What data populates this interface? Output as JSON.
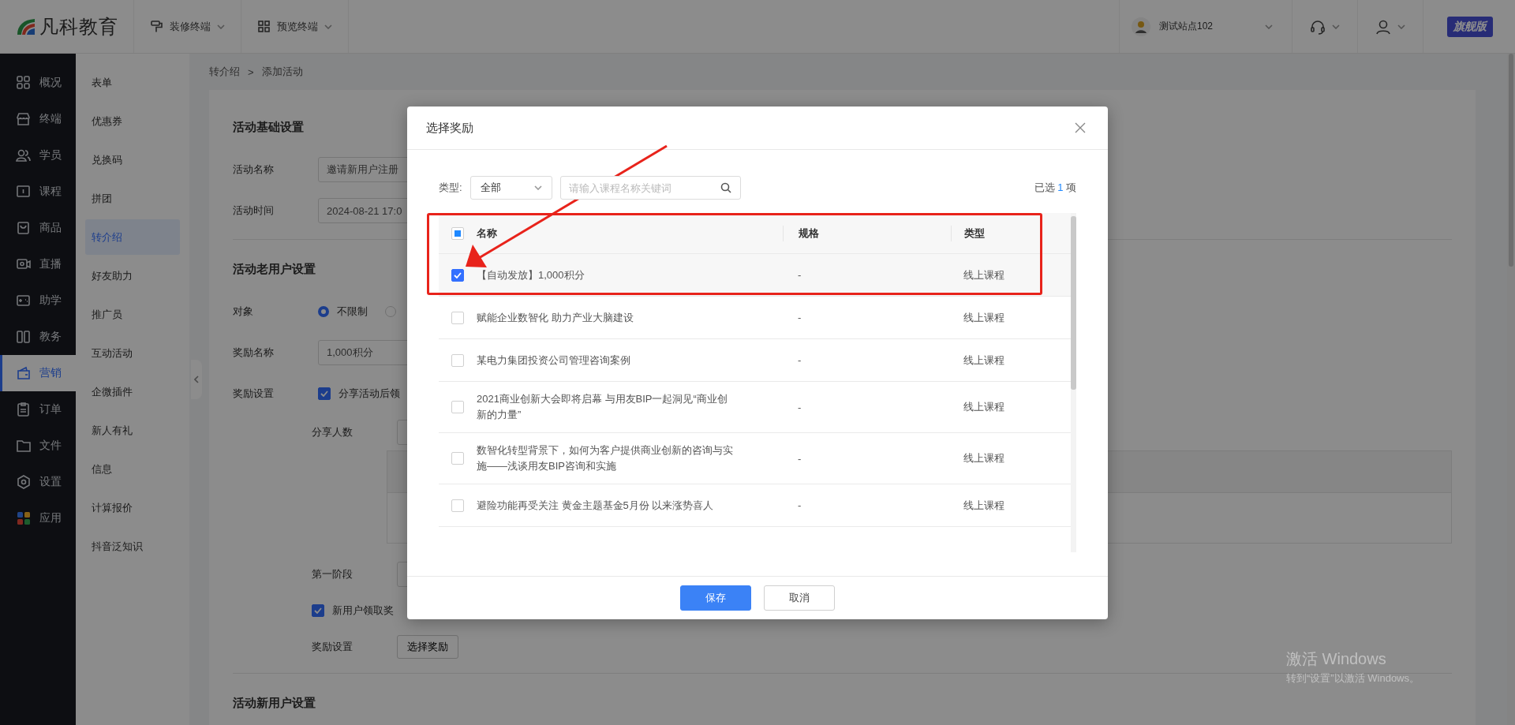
{
  "topbar": {
    "logo_text": "凡科教育",
    "tools": [
      {
        "label": "装修终端"
      },
      {
        "label": "预览终端"
      }
    ],
    "site": {
      "name": "测试站点102"
    },
    "edition_badge": "旗舰版"
  },
  "nav": [
    {
      "label": "概况",
      "selected": false
    },
    {
      "label": "终端",
      "selected": false
    },
    {
      "label": "学员",
      "selected": false
    },
    {
      "label": "课程",
      "selected": false
    },
    {
      "label": "商品",
      "selected": false
    },
    {
      "label": "直播",
      "selected": false
    },
    {
      "label": "助学",
      "selected": false
    },
    {
      "label": "教务",
      "selected": false
    },
    {
      "label": "营销",
      "selected": true
    },
    {
      "label": "订单",
      "selected": false
    },
    {
      "label": "文件",
      "selected": false
    },
    {
      "label": "设置",
      "selected": false
    },
    {
      "label": "应用",
      "selected": false
    }
  ],
  "subnav": [
    {
      "label": "表单",
      "selected": false
    },
    {
      "label": "优惠券",
      "selected": false
    },
    {
      "label": "兑换码",
      "selected": false
    },
    {
      "label": "拼团",
      "selected": false
    },
    {
      "label": "转介绍",
      "selected": true
    },
    {
      "label": "好友助力",
      "selected": false
    },
    {
      "label": "推广员",
      "selected": false
    },
    {
      "label": "互动活动",
      "selected": false
    },
    {
      "label": "企微插件",
      "selected": false
    },
    {
      "label": "新人有礼",
      "selected": false
    },
    {
      "label": "信息",
      "selected": false
    },
    {
      "label": "计算报价",
      "selected": false
    },
    {
      "label": "抖音泛知识",
      "selected": false
    }
  ],
  "breadcrumb": {
    "items": [
      "转介绍",
      "添加活动"
    ],
    "separator": ">"
  },
  "form": {
    "basic_title": "活动基础设置",
    "name_label": "活动名称",
    "name_value": "邀请新用户注册",
    "time_label": "活动时间",
    "time_value": "2024-08-21 17:0",
    "old_title": "活动老用户设置",
    "target_label": "对象",
    "target_options": [
      {
        "label": "不限制",
        "selected": true
      },
      {
        "selected": false
      }
    ],
    "reward_name_label": "奖励名称",
    "reward_name_value": "1,000积分",
    "reward_setting_label": "奖励设置",
    "share_checked": true,
    "share_text": "分享活动后领",
    "share_count_label": "分享人数",
    "stage_label": "第一阶段",
    "newuser_checked": true,
    "newuser_text": "新用户领取奖",
    "reward_setting2_label": "奖励设置",
    "choose_button": "选择奖励",
    "new_title": "活动新用户设置"
  },
  "modal": {
    "title": "选择奖励",
    "type_label": "类型:",
    "type_value": "全部",
    "search": {
      "placeholder": "请输入课程名称关键词"
    },
    "selected_summary": {
      "prefix": "已选",
      "count": "1",
      "suffix": "项"
    },
    "table": {
      "columns": [
        "名称",
        "规格",
        "类型"
      ],
      "header_checkbox": {
        "indeterminate": true
      },
      "rows": [
        {
          "name": "【自动发放】1,000积分",
          "spec": "-",
          "type": "线上课程",
          "checked": true
        },
        {
          "name": "赋能企业数智化 助力产业大脑建设",
          "spec": "-",
          "type": "线上课程",
          "checked": false
        },
        {
          "name": "某电力集团投资公司管理咨询案例",
          "spec": "-",
          "type": "线上课程",
          "checked": false
        },
        {
          "name": "2021商业创新大会即将启幕 与用友BIP一起洞见“商业创新的力量”",
          "spec": "-",
          "type": "线上课程",
          "checked": false
        },
        {
          "name": "数智化转型背景下，如何为客户提供商业创新的咨询与实施——浅谈用友BIP咨询和实施",
          "spec": "-",
          "type": "线上课程",
          "checked": false
        },
        {
          "name": "避险功能再受关注 黄金主题基金5月份 以来涨势喜人",
          "spec": "-",
          "type": "线上课程",
          "checked": false
        }
      ]
    },
    "buttons": [
      {
        "label": "保存",
        "kind": "primary"
      },
      {
        "label": "取消",
        "kind": "default"
      }
    ]
  },
  "os_notice": {
    "title": "激活 Windows",
    "subtitle": "转到“设置”以激活 Windows。"
  }
}
